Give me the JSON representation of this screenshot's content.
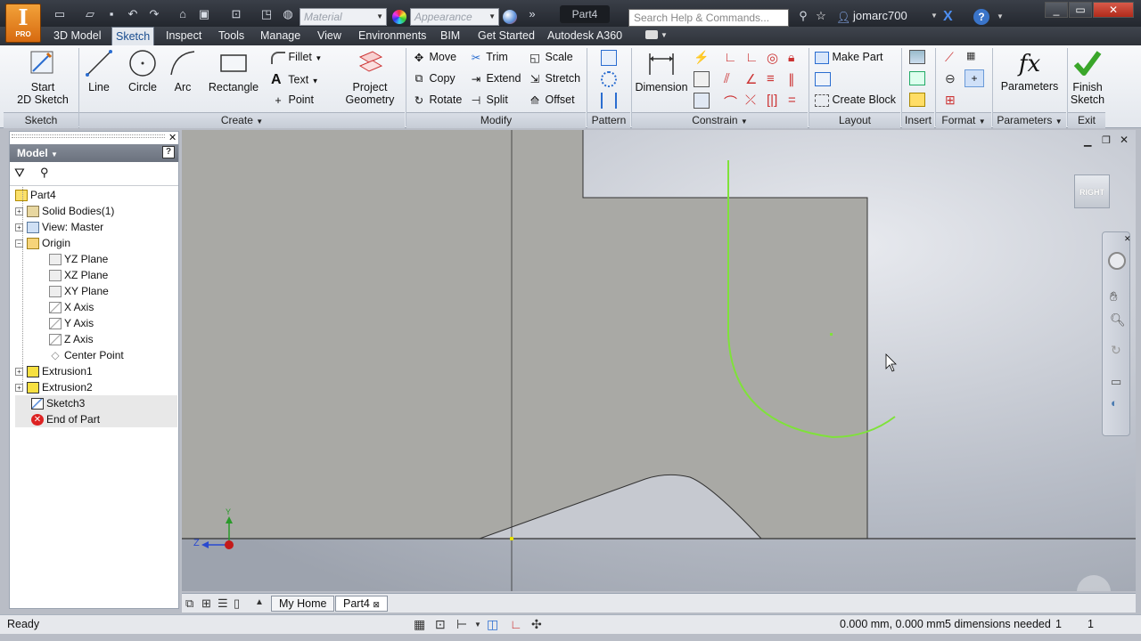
{
  "window": {
    "doc_title": "Part4",
    "search_placeholder": "Search Help & Commands...",
    "user": "jomarc700",
    "app_letter": "I",
    "app_edition": "PRO"
  },
  "qat": {
    "material_placeholder": "Material",
    "appearance_placeholder": "Appearance"
  },
  "tabs": [
    "3D Model",
    "Sketch",
    "Inspect",
    "Tools",
    "Manage",
    "View",
    "Environments",
    "BIM",
    "Get Started",
    "Autodesk A360"
  ],
  "active_tab": "Sketch",
  "ribbon": {
    "start_2d_sketch": "Start\n2D Sketch",
    "start_line1": "Start",
    "start_line2": "2D Sketch",
    "line": "Line",
    "circle": "Circle",
    "arc": "Arc",
    "rectangle": "Rectangle",
    "fillet": "Fillet",
    "text": "Text",
    "point": "Point",
    "project_line1": "Project",
    "project_line2": "Geometry",
    "move": "Move",
    "copy": "Copy",
    "rotate": "Rotate",
    "trim": "Trim",
    "extend": "Extend",
    "split": "Split",
    "scale": "Scale",
    "stretch": "Stretch",
    "offset": "Offset",
    "dimension": "Dimension",
    "make_part": "Make Part",
    "create_block": "Create Block",
    "parameters": "Parameters",
    "finish_line1": "Finish",
    "finish_line2": "Sketch",
    "panels": {
      "sketch": "Sketch",
      "create": "Create",
      "modify": "Modify",
      "pattern": "Pattern",
      "constrain": "Constrain",
      "layout": "Layout",
      "insert": "Insert",
      "format": "Format",
      "parameters": "Parameters",
      "exit": "Exit"
    }
  },
  "browser": {
    "title": "Model",
    "items": [
      {
        "label": "Part4"
      },
      {
        "label": "Solid Bodies(1)"
      },
      {
        "label": "View: Master"
      },
      {
        "label": "Origin"
      },
      {
        "label": "YZ Plane"
      },
      {
        "label": "XZ Plane"
      },
      {
        "label": "XY Plane"
      },
      {
        "label": "X Axis"
      },
      {
        "label": "Y Axis"
      },
      {
        "label": "Z Axis"
      },
      {
        "label": "Center Point"
      },
      {
        "label": "Extrusion1"
      },
      {
        "label": "Extrusion2"
      },
      {
        "label": "Sketch3"
      },
      {
        "label": "End of Part"
      }
    ]
  },
  "viewport": {
    "viewcube_label": "RIGHT",
    "axis_z": "Z",
    "axis_y": "Y"
  },
  "doc_tabs": [
    "My Home",
    "Part4"
  ],
  "status": {
    "left": "Ready",
    "coords": "0.000 mm, 0.000 mm",
    "dims_needed": "5 dimensions needed",
    "count1": "1",
    "count2": "1"
  },
  "colors": {
    "sketch_green": "#7fe23a",
    "accent_blue": "#1a4d8f"
  }
}
